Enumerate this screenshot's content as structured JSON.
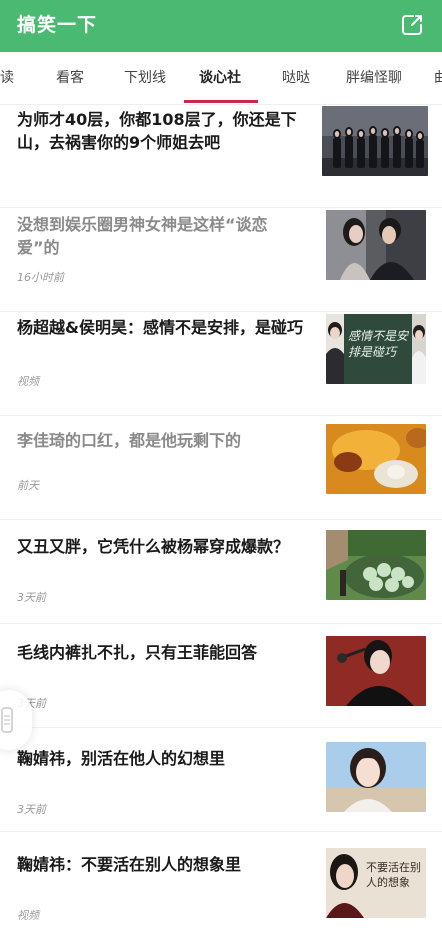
{
  "header": {
    "title": "搞笑一下",
    "share_icon": "share-icon",
    "background_color": "#4aba73"
  },
  "tabs": [
    {
      "label": "读"
    },
    {
      "label": "看客"
    },
    {
      "label": "下划线"
    },
    {
      "label": "谈心社",
      "active": true
    },
    {
      "label": "哒哒"
    },
    {
      "label": "胖编怪聊"
    },
    {
      "label": "曲"
    }
  ],
  "accent_color": "#c9284b",
  "articles": [
    {
      "title": "为师才40层，你都108层了，你还是下山，去祸害你的9个师姐去吧",
      "meta": "",
      "read": false,
      "image": "group-photo"
    },
    {
      "title": "没想到娱乐圈男神女神是这样“谈恋爱”的",
      "meta": "16小时前",
      "read": true,
      "image": "couple-photo"
    },
    {
      "title": "杨超越&侯明昊：感情不是安排，是碰巧",
      "meta": "视频",
      "read": false,
      "image": "chalkboard-photo"
    },
    {
      "title": "李佳琦的口红，都是他玩剩下的",
      "meta": "前天",
      "read": true,
      "image": "food-photo"
    },
    {
      "title": "又丑又胖，它凭什么被杨幂穿成爆款？",
      "meta": "3天前",
      "read": false,
      "image": "basket-photo"
    },
    {
      "title": "毛线内裤扎不扎，只有王菲能回答",
      "meta": "3天前",
      "read": false,
      "image": "singer-photo"
    },
    {
      "title": "鞠婧祎，别活在他人的幻想里",
      "meta": "3天前",
      "read": false,
      "image": "portrait-photo"
    },
    {
      "title": "鞠婧祎：不要活在别人的想象里",
      "meta": "视频",
      "read": false,
      "image": "calligraphy-photo"
    }
  ],
  "thumb_texts": {
    "chalkboard": "感情不是安排是碰巧",
    "calligraphy": "不要活在别人的想象"
  }
}
